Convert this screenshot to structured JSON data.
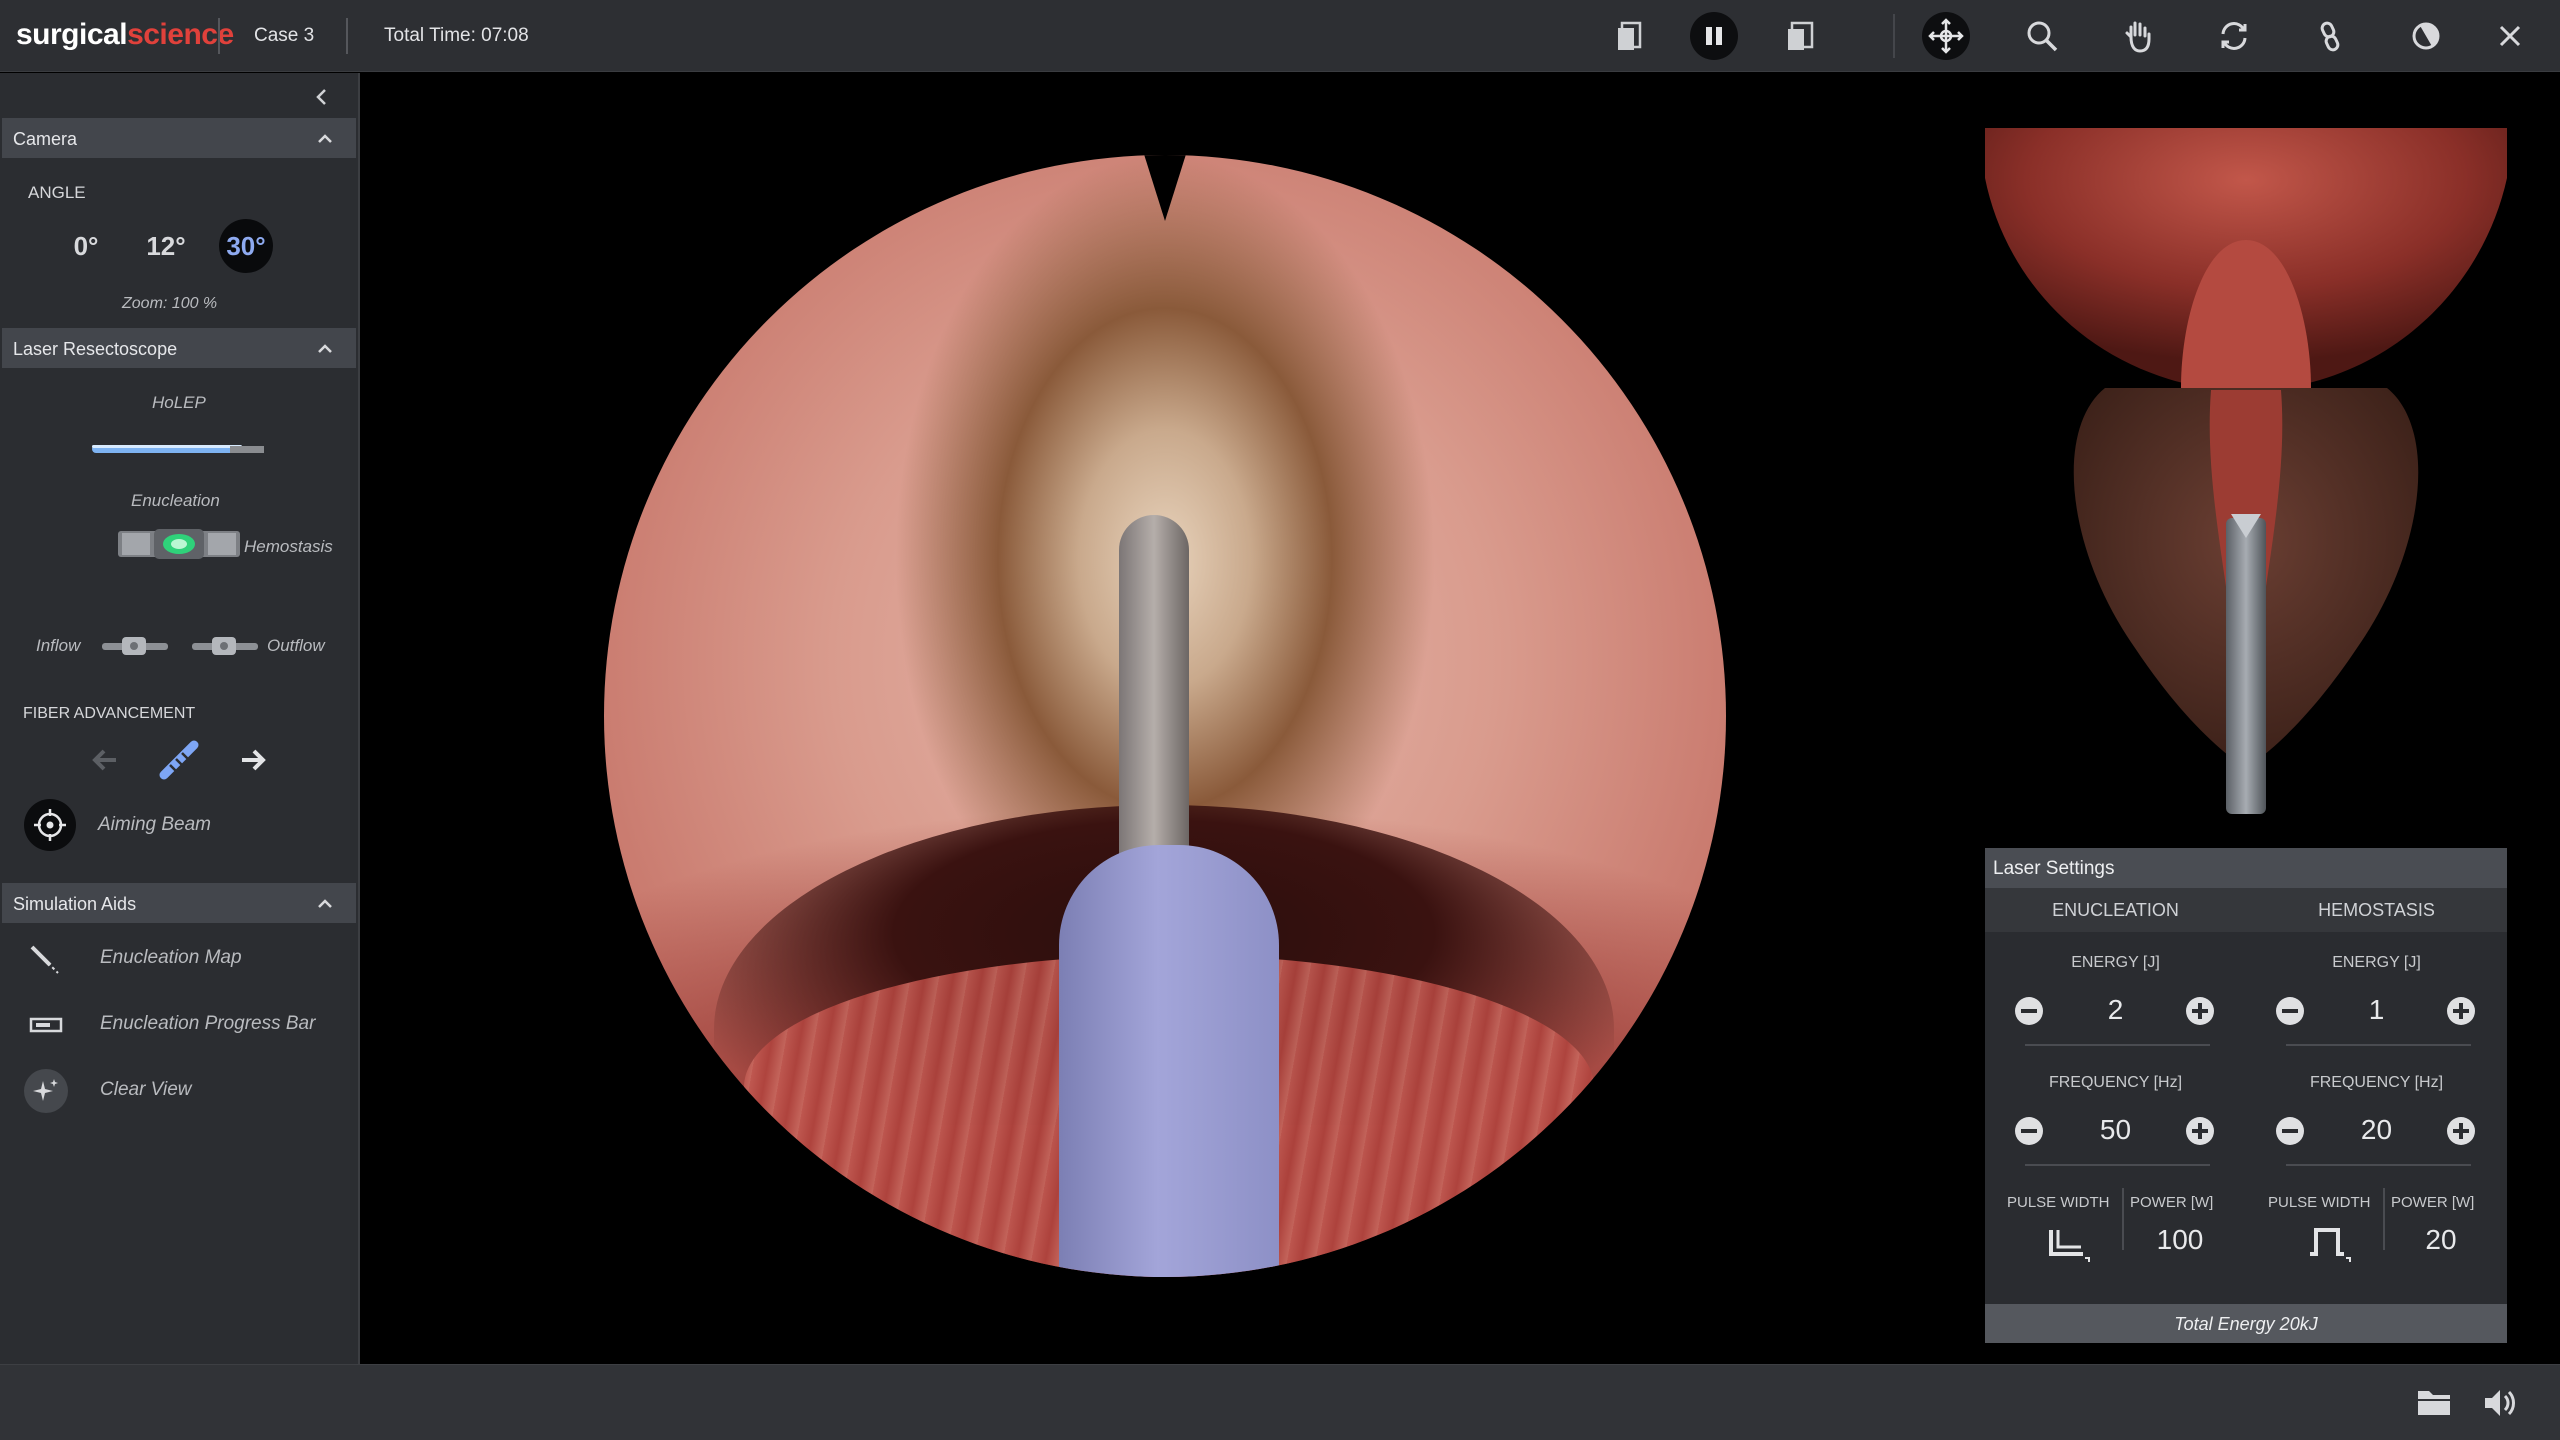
{
  "app": {
    "brand_part1": "surgical",
    "brand_part2": "science",
    "case": "Case 3",
    "total_time": "Total Time: 07:08"
  },
  "toolbar": {
    "icons": [
      "layout-left-icon",
      "pause-icon",
      "layout-right-icon",
      "camera-move-icon",
      "zoom-icon",
      "hand-icon",
      "rotate-icon",
      "link-icon",
      "transparency-icon",
      "close-icon"
    ],
    "active": "camera-move-icon"
  },
  "camera": {
    "title": "Camera",
    "angle_label": "ANGLE",
    "angles": [
      "0°",
      "12°",
      "30°"
    ],
    "selected_angle": "30°",
    "zoom": "Zoom: 100 %"
  },
  "laser_resectoscope": {
    "title": "Laser Resectoscope",
    "instrument": "HoLEP",
    "mode_left": "Enucleation",
    "mode_right": "Hemostasis",
    "inflow": "Inflow",
    "outflow": "Outflow",
    "fiber_advancement": "FIBER ADVANCEMENT",
    "aiming_beam": "Aiming Beam"
  },
  "simulation_aids": {
    "title": "Simulation Aids",
    "items": [
      {
        "label": "Enucleation Map",
        "icon": "map-icon"
      },
      {
        "label": "Enucleation Progress Bar",
        "icon": "progress-bar-icon"
      },
      {
        "label": "Clear View",
        "icon": "sparkle-icon"
      }
    ]
  },
  "laser_settings": {
    "title": "Laser Settings",
    "enucleation": {
      "title": "ENUCLEATION",
      "energy_label": "ENERGY [J]",
      "energy": "2",
      "frequency_label": "FREQUENCY [Hz]",
      "frequency": "50",
      "pulse_label": "PULSE WIDTH",
      "power_label": "POWER [W]",
      "power": "100"
    },
    "hemostasis": {
      "title": "HEMOSTASIS",
      "energy_label": "ENERGY [J]",
      "energy": "1",
      "frequency_label": "FREQUENCY [Hz]",
      "frequency": "20",
      "pulse_label": "PULSE WIDTH",
      "power_label": "POWER [W]",
      "power": "20"
    },
    "total_energy": "Total Energy 20kJ"
  },
  "colors": {
    "brand_red": "#e0413b",
    "active_angle": "#8eaaf0",
    "panel_bg": "#2b2d31",
    "section_header": "#43464c"
  }
}
